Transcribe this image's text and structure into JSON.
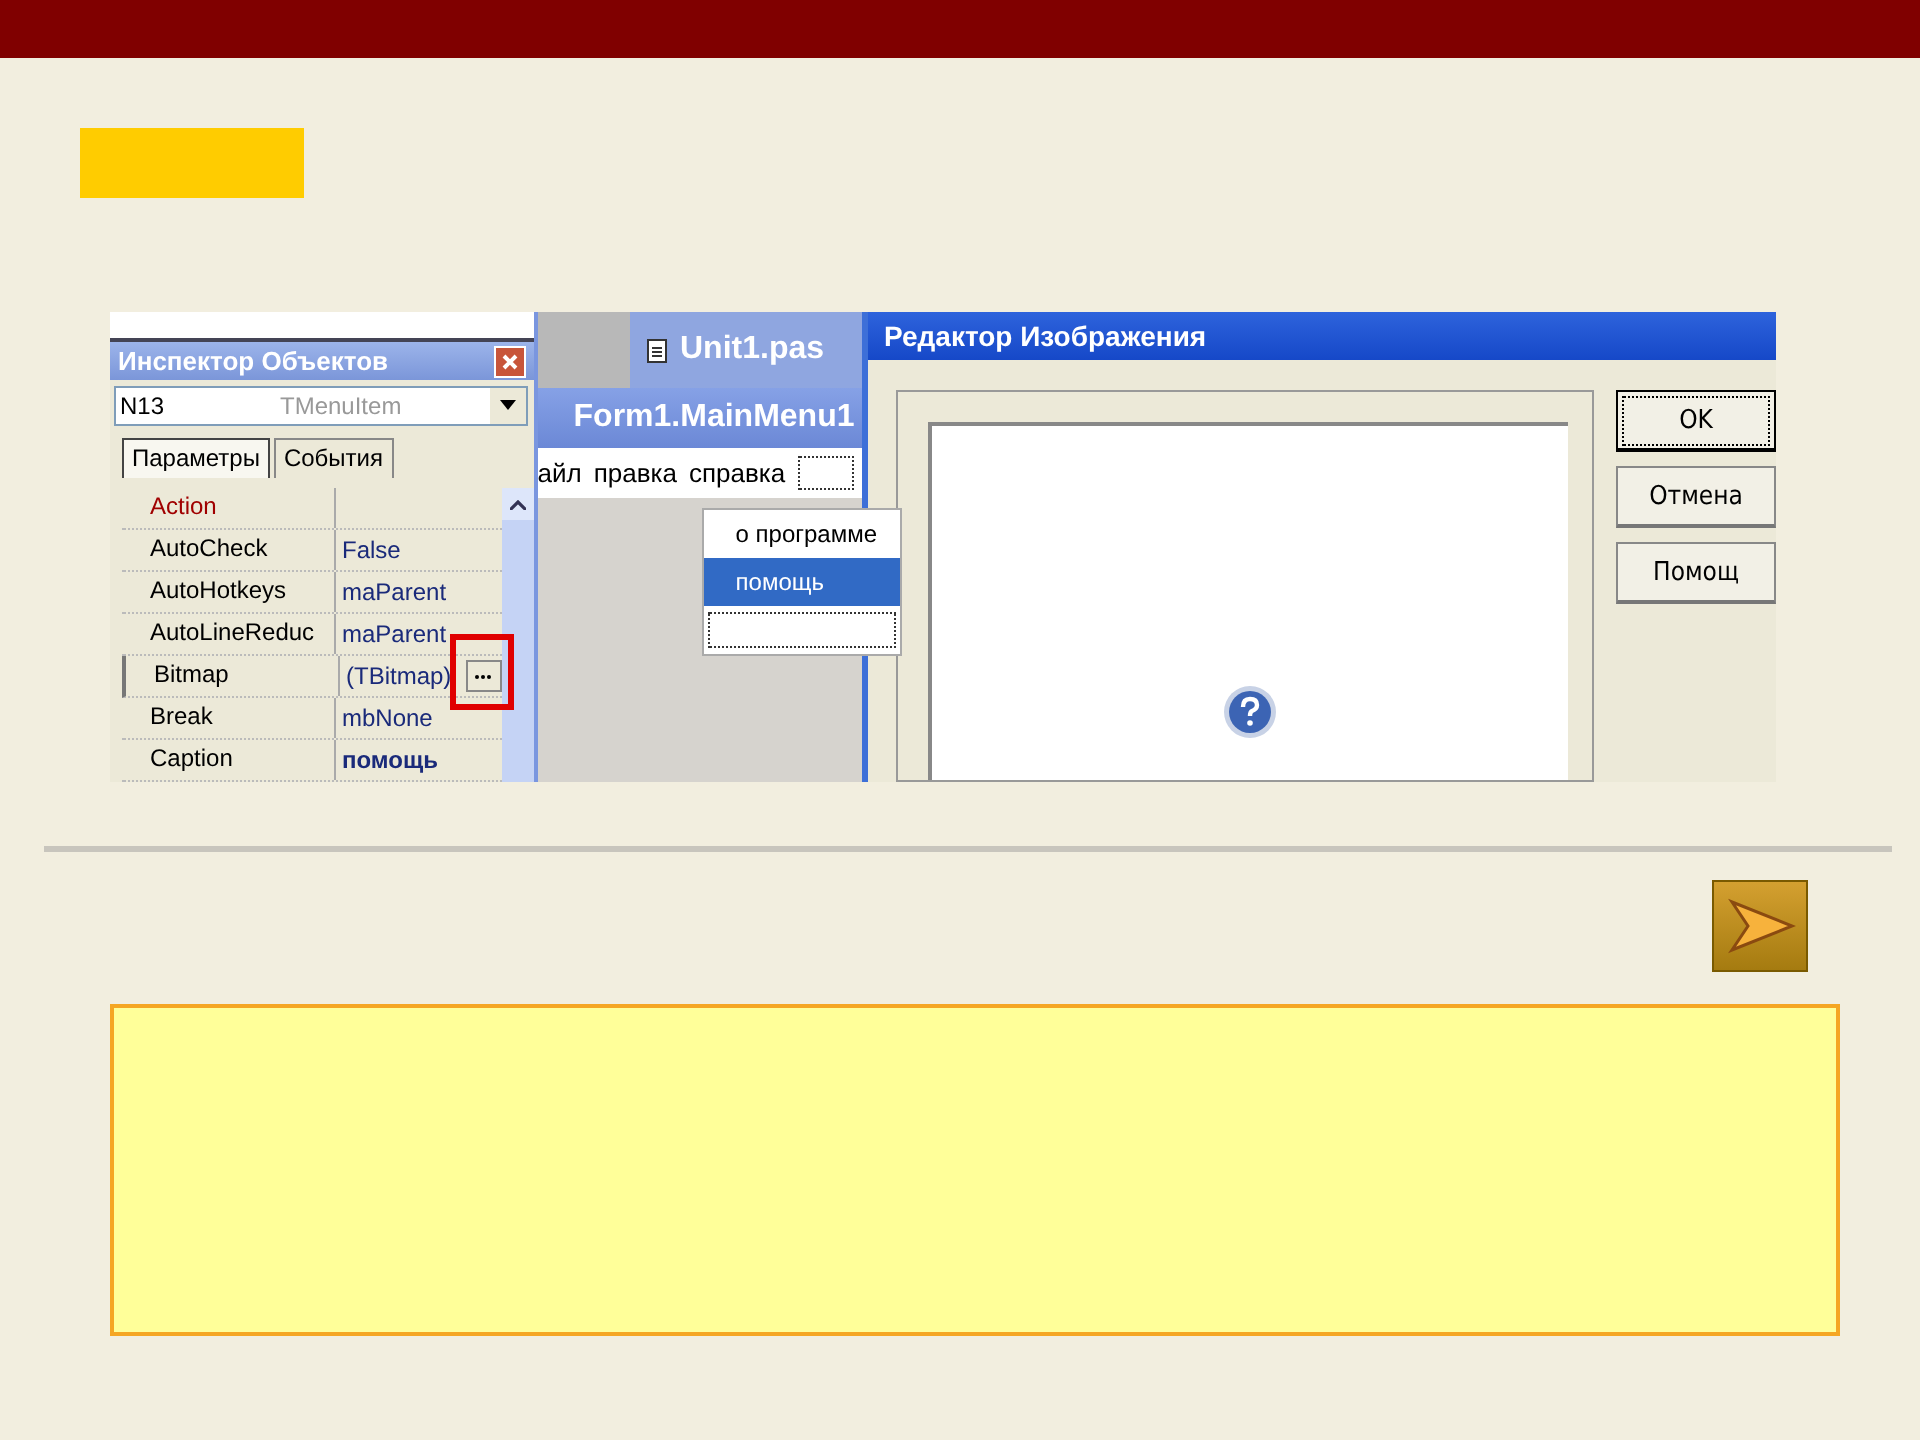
{
  "screenshot": {
    "inspector": {
      "title": "Инспектор Объектов",
      "object_name": "N13",
      "object_type": "TMenuItem",
      "tabs": [
        {
          "label": "Параметры",
          "selected": true
        },
        {
          "label": "События",
          "selected": false
        }
      ],
      "properties": [
        {
          "name": "Action",
          "kind": "reference",
          "selected": false
        },
        {
          "name": "AutoCheck",
          "value": "False",
          "kind": "plain",
          "selected": false
        },
        {
          "name": "AutoHotkeys",
          "value": "maParent",
          "kind": "plain",
          "selected": false
        },
        {
          "name": "AutoLineReduc",
          "value": "maParent",
          "kind": "plain",
          "selected": false
        },
        {
          "name": "Bitmap",
          "value": "(TBitmap)",
          "kind": "ellipsis",
          "selected": true
        },
        {
          "name": "Break",
          "value": "mbNone",
          "kind": "plain",
          "selected": false
        },
        {
          "name": "Caption",
          "value": "помощь",
          "kind": "bold",
          "selected": false
        }
      ]
    },
    "editor_tab": "Unit1.pas",
    "menu_designer": {
      "title": "Form1.MainMenu1",
      "menu_bar": [
        "айл",
        "правка",
        "справка"
      ],
      "submenu": [
        {
          "label": "о программе",
          "selected": false
        },
        {
          "label": "помощь",
          "selected": true
        }
      ]
    },
    "dialog": {
      "title": "Редактор Изображения",
      "buttons": [
        {
          "label": "OK",
          "focused": true
        },
        {
          "label": "Отмена",
          "focused": false
        },
        {
          "label": "Помощ",
          "focused": false
        }
      ]
    }
  }
}
